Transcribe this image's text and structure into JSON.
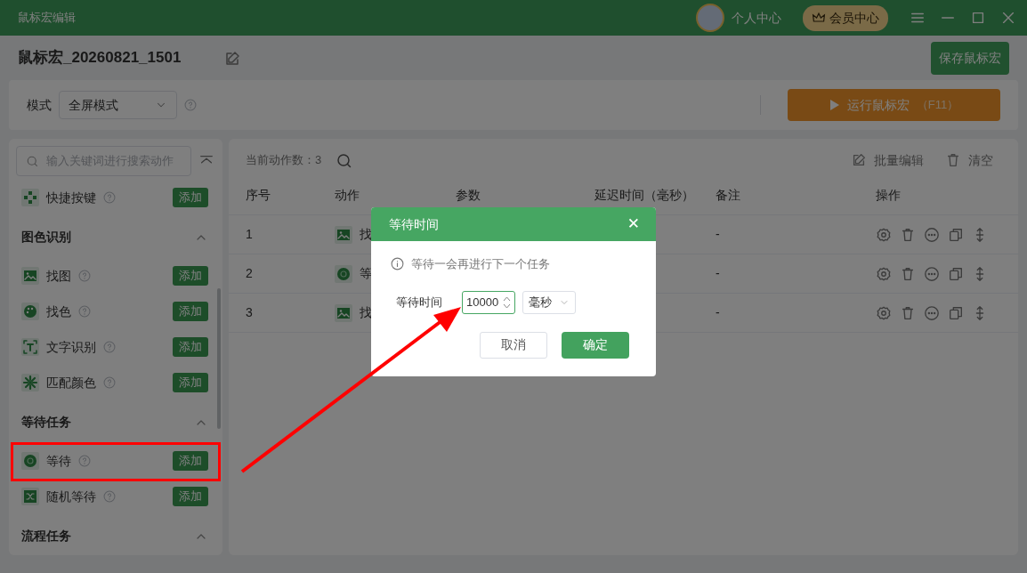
{
  "window": {
    "title": "鼠标宏编辑"
  },
  "user": {
    "profile": "个人中心",
    "vip": "会员中心"
  },
  "macro": {
    "name": "鼠标宏_20260821_1501",
    "save": "保存鼠标宏"
  },
  "mode": {
    "label": "模式",
    "value": "全屏模式",
    "run": "运行鼠标宏",
    "run_key": "（F11）"
  },
  "sidebar": {
    "search_placeholder": "输入关键词进行搜索动作",
    "entries": [
      {
        "kind": "item",
        "label": "快捷按键",
        "add": "添加"
      },
      {
        "kind": "section",
        "label": "图色识别",
        "expanded": true
      },
      {
        "kind": "item",
        "label": "找图",
        "add": "添加"
      },
      {
        "kind": "item",
        "label": "找色",
        "add": "添加"
      },
      {
        "kind": "item",
        "label": "文字识别",
        "add": "添加"
      },
      {
        "kind": "item",
        "label": "匹配颜色",
        "add": "添加"
      },
      {
        "kind": "section",
        "label": "等待任务",
        "expanded": true
      },
      {
        "kind": "item",
        "label": "等待",
        "add": "添加"
      },
      {
        "kind": "item",
        "label": "随机等待",
        "add": "添加"
      },
      {
        "kind": "section",
        "label": "流程任务",
        "expanded": true
      }
    ]
  },
  "table": {
    "count_label": "当前动作数：3",
    "batch_edit": "批量编辑",
    "clear": "清空",
    "columns": [
      "序号",
      "动作",
      "参数",
      "延迟时间（毫秒）",
      "备注",
      "操作"
    ],
    "rows": [
      {
        "index": "1",
        "action": "找",
        "note": "-"
      },
      {
        "index": "2",
        "action": "等",
        "note": "-"
      },
      {
        "index": "3",
        "action": "找",
        "note": "-"
      }
    ]
  },
  "dialog": {
    "title": "等待时间",
    "close": "✕",
    "info": "等待一会再进行下一个任务",
    "field_label": "等待时间",
    "value": "10000",
    "unit": "毫秒",
    "cancel": "取消",
    "ok": "确定"
  }
}
